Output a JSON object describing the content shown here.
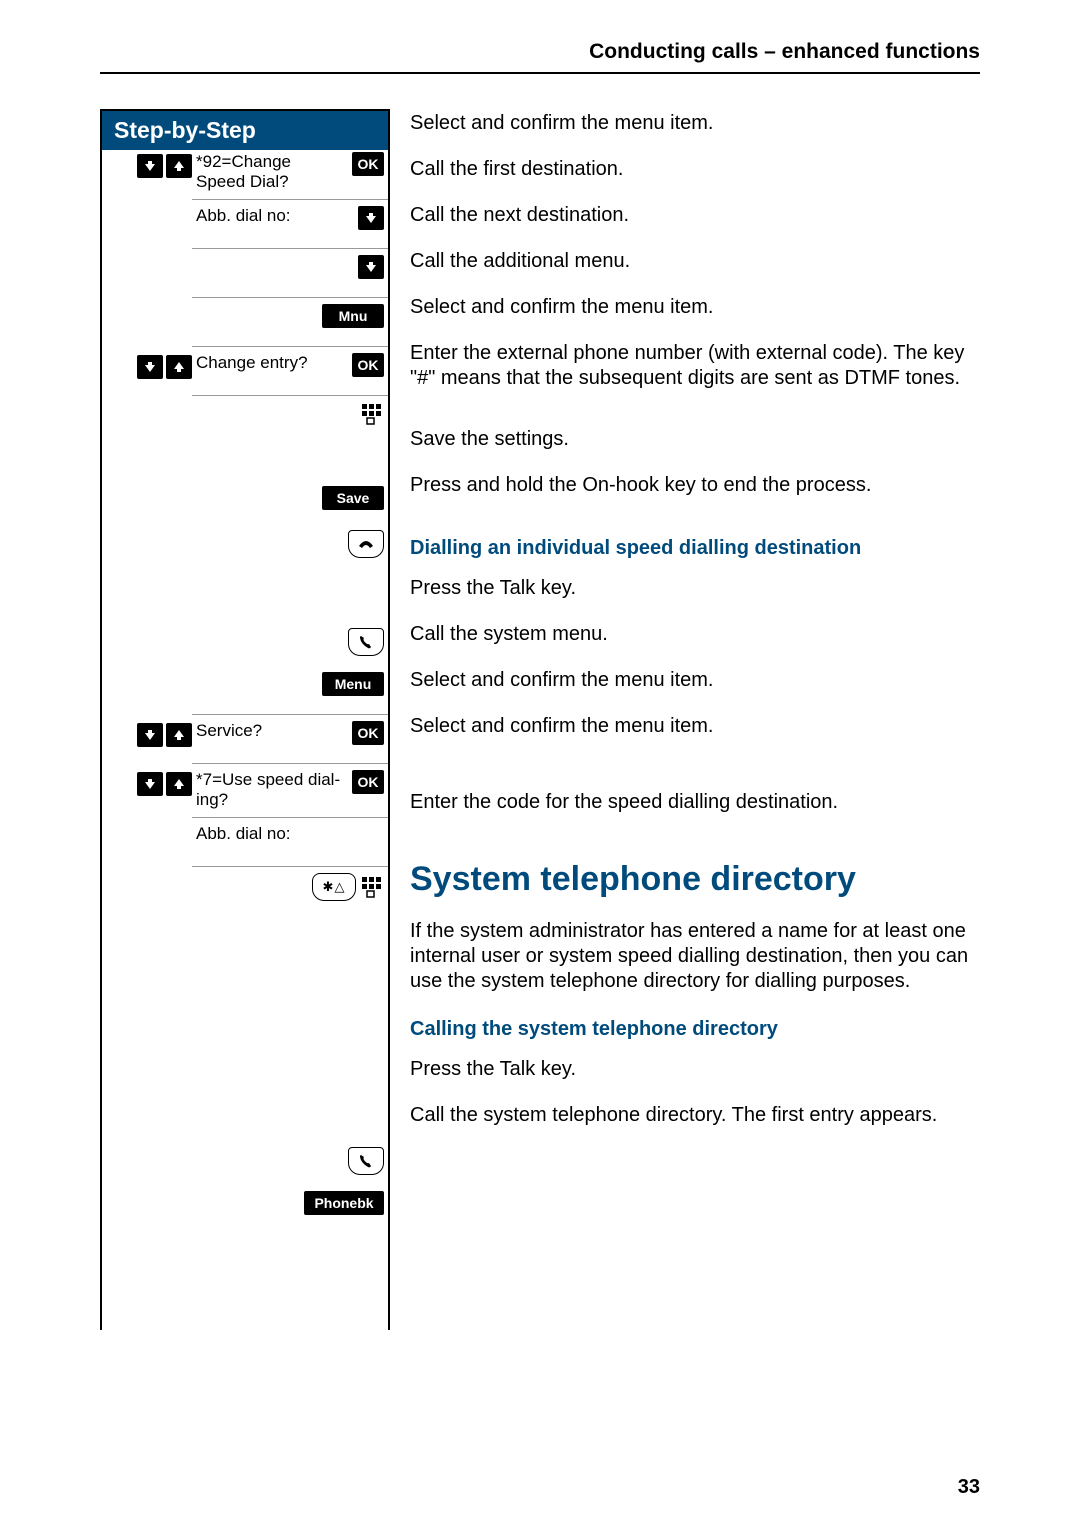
{
  "header": "Conducting calls – enhanced functions",
  "page_number": "33",
  "step_title": "Step-by-Step",
  "labels": {
    "ok": "OK",
    "mnu": "Mnu",
    "save": "Save",
    "menu": "Menu",
    "phonebk": "Phonebk"
  },
  "display": {
    "change_speed": "*92=Change Speed Dial?",
    "abb_dial_no": "Abb. dial no:",
    "change_entry": "Change entry?",
    "service": "Service?",
    "use_speed": "*7=Use speed dial-ing?"
  },
  "instr": {
    "r1": "Select and confirm the menu item.",
    "r2": "Call the first destination.",
    "r3": "Call the next destination.",
    "r4": "Call the additional menu.",
    "r5": "Select and confirm the menu item.",
    "r6": "Enter the external phone number (with external code). The key \"#\" means that the subsequent digits are sent as DTMF tones.",
    "r7": "Save the settings.",
    "r8": "Press and hold the On-hook key to end the process.",
    "sub1": "Dialling an individual speed dialling destination",
    "r9": "Press the Talk key.",
    "r10": "Call the system menu.",
    "r11": "Select and confirm the menu item.",
    "r12": "Select and confirm the menu item.",
    "r13": "Enter the code for the speed dialling destination.",
    "h2": "System telephone directory",
    "p1": "If the system administrator has entered a name for at least one internal user or system speed dialling destination, then you can use the system telephone directory for dialling purposes.",
    "sub2": "Calling the system telephone directory",
    "r14": "Press the Talk key.",
    "r15": "Call the system telephone directory. The first entry appears."
  }
}
